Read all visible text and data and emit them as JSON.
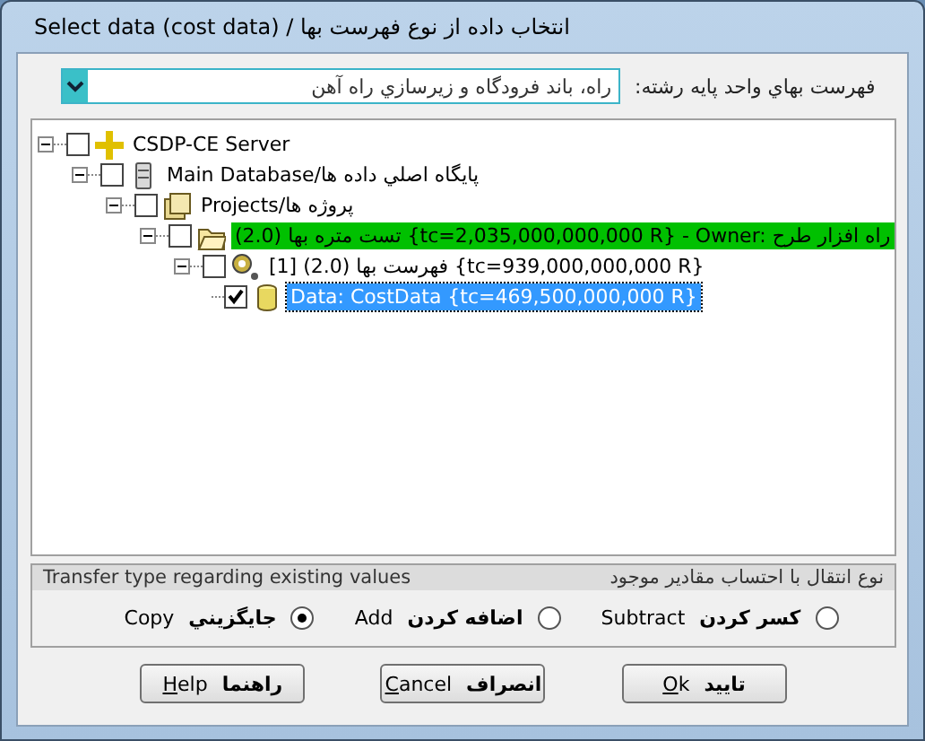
{
  "window": {
    "title": "Select data (cost data) / انتخاب داده از نوع فهرست بها"
  },
  "price_list": {
    "label": "فهرست بهاي واحد پايه رشته:",
    "value": "راه، باند فرودگاه و زيرسازي راه آهن"
  },
  "tree": [
    {
      "kind": "server",
      "label": "CSDP-CE Server",
      "expanded": true,
      "checked": false,
      "selected": false,
      "children": [
        {
          "kind": "database",
          "label": "Main Database/پايگاه اصلي داده ها",
          "expanded": true,
          "checked": false,
          "selected": false,
          "children": [
            {
              "kind": "projects",
              "label": "Projects/پروژه ها",
              "expanded": true,
              "checked": false,
              "selected": false,
              "children": [
                {
                  "kind": "folder",
                  "label": "(2.0) تست متره بها {tc=2,035,000,000,000 R} - Owner: راه افزار طرح",
                  "color": "#00c000",
                  "expanded": true,
                  "checked": false,
                  "selected": false,
                  "children": [
                    {
                      "kind": "pricelist",
                      "label": "[1] (2.0) فهرست بها {tc=939,000,000,000 R}",
                      "expanded": true,
                      "checked": false,
                      "selected": false,
                      "children": [
                        {
                          "kind": "data",
                          "label": "Data: CostData {tc=469,500,000,000 R}",
                          "checked": true,
                          "selected": true
                        }
                      ]
                    }
                  ]
                }
              ]
            }
          ]
        }
      ]
    }
  ],
  "transfer": {
    "caption_en": "Transfer type regarding existing values",
    "caption_fa": "نوع انتقال با احتساب مقادير موجود",
    "options": [
      {
        "en": "Subtract",
        "fa": "كسر كردن",
        "selected": false
      },
      {
        "en": "Add",
        "fa": "اضافه كردن",
        "selected": false
      },
      {
        "en": "Copy",
        "fa": "جايگزيني",
        "selected": true
      }
    ]
  },
  "buttons": [
    {
      "en": "Ok",
      "fa": "تاييد"
    },
    {
      "en": "Cancel",
      "fa": "انصراف"
    },
    {
      "en": "Help",
      "fa": "راهنما"
    }
  ]
}
